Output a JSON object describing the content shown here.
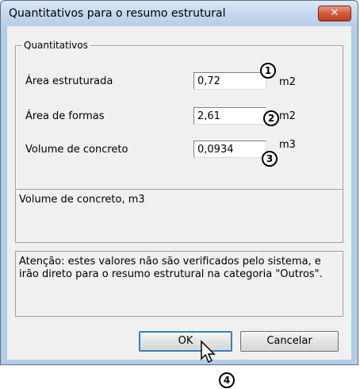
{
  "window": {
    "title": "Quantitativos para o resumo estrutural",
    "close_glyph": "✕"
  },
  "group": {
    "legend": "Quantitativos",
    "fields": [
      {
        "label": "Área estruturada",
        "value": "0,72",
        "unit": "m2",
        "marker": "1"
      },
      {
        "label": "Área de formas",
        "value": "2,61",
        "unit": "m2",
        "marker": "2"
      },
      {
        "label": "Volume de concreto",
        "value": "0,0934",
        "unit": "m3",
        "marker": "3"
      }
    ]
  },
  "description": "Volume de concreto, m3",
  "note": "Atenção: estes valores não são verificados pelo sistema, e irão direto para o resumo estrutural na categoria \"Outros\".",
  "buttons": {
    "ok": "OK",
    "cancel": "Cancelar",
    "ok_marker": "4"
  },
  "icons": {
    "close": "close-icon",
    "cursor": "mouse-pointer-icon"
  }
}
